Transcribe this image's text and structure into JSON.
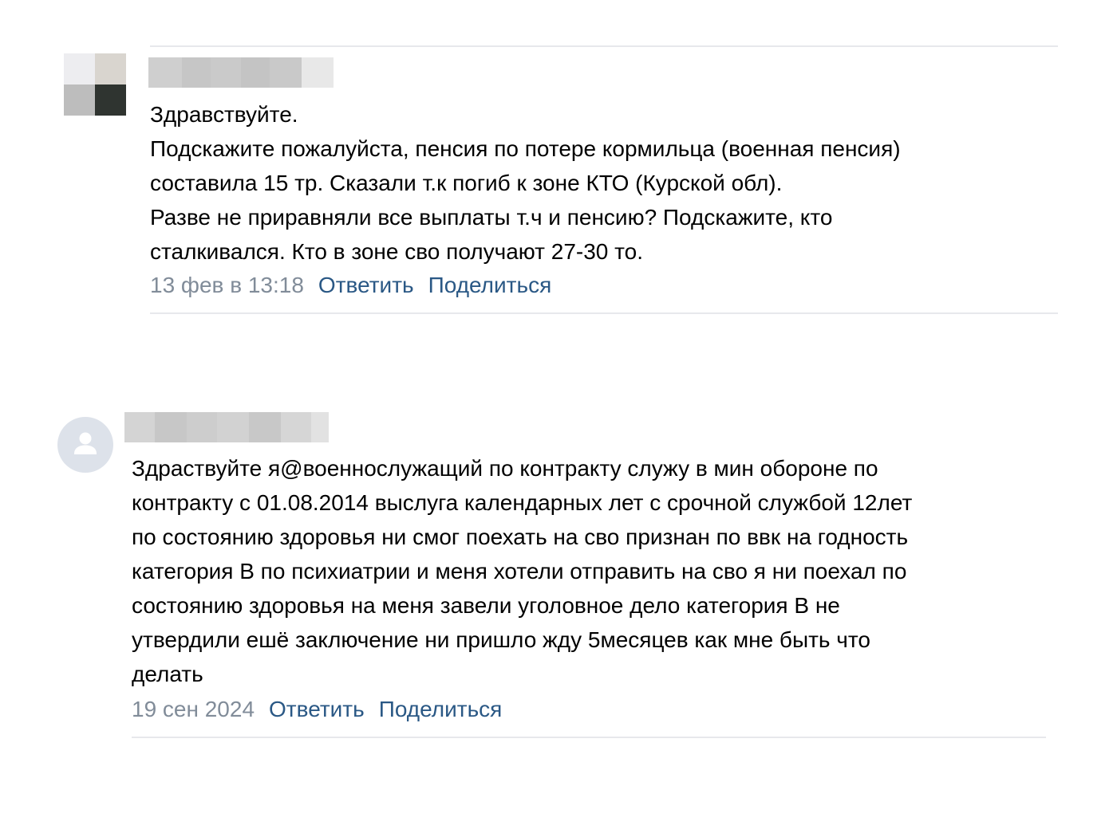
{
  "comments": [
    {
      "author_redacted": true,
      "avatar_redacted": true,
      "text_lines": [
        "Здравствуйте.",
        "Подскажите пожалуйста, пенсия по потере кормильца (военная пенсия)",
        "составила 15 тр. Сказали т.к погиб к зоне КТО (Курской обл).",
        "Разве не приравняли все выплаты т.ч и пенсию? Подскажите, кто",
        "сталкивался. Кто в зоне сво получают 27-30 то."
      ],
      "date": "13 фев в 13:18",
      "reply_label": "Ответить",
      "share_label": "Поделиться"
    },
    {
      "author_redacted": true,
      "avatar_icon": "default-user-avatar-icon",
      "text_lines": [
        "Здраствуйте я@военнослужащий по контракту служу в мин обороне по",
        "контракту с 01.08.2014 выслуга календарных лет с срочной службой 12лет",
        "по состоянию здоровья ни смог поехать на сво признан по ввк на годность",
        "категория В по психиатрии и меня хотели отправить на сво я ни поехал по",
        "состоянию здоровья на меня завели уголовное дело категория В не",
        "утвердили ешё заключение ни пришло жду 5месяцев как мне быть что",
        "делать"
      ],
      "date": "19 сен 2024",
      "reply_label": "Ответить",
      "share_label": "Поделиться"
    }
  ],
  "colors": {
    "text": "#000000",
    "date": "#818c99",
    "link": "#2a5885",
    "divider": "#e7e8ec",
    "avatar_bg": "#dde2ea",
    "avatar_fg": "#ffffff"
  }
}
